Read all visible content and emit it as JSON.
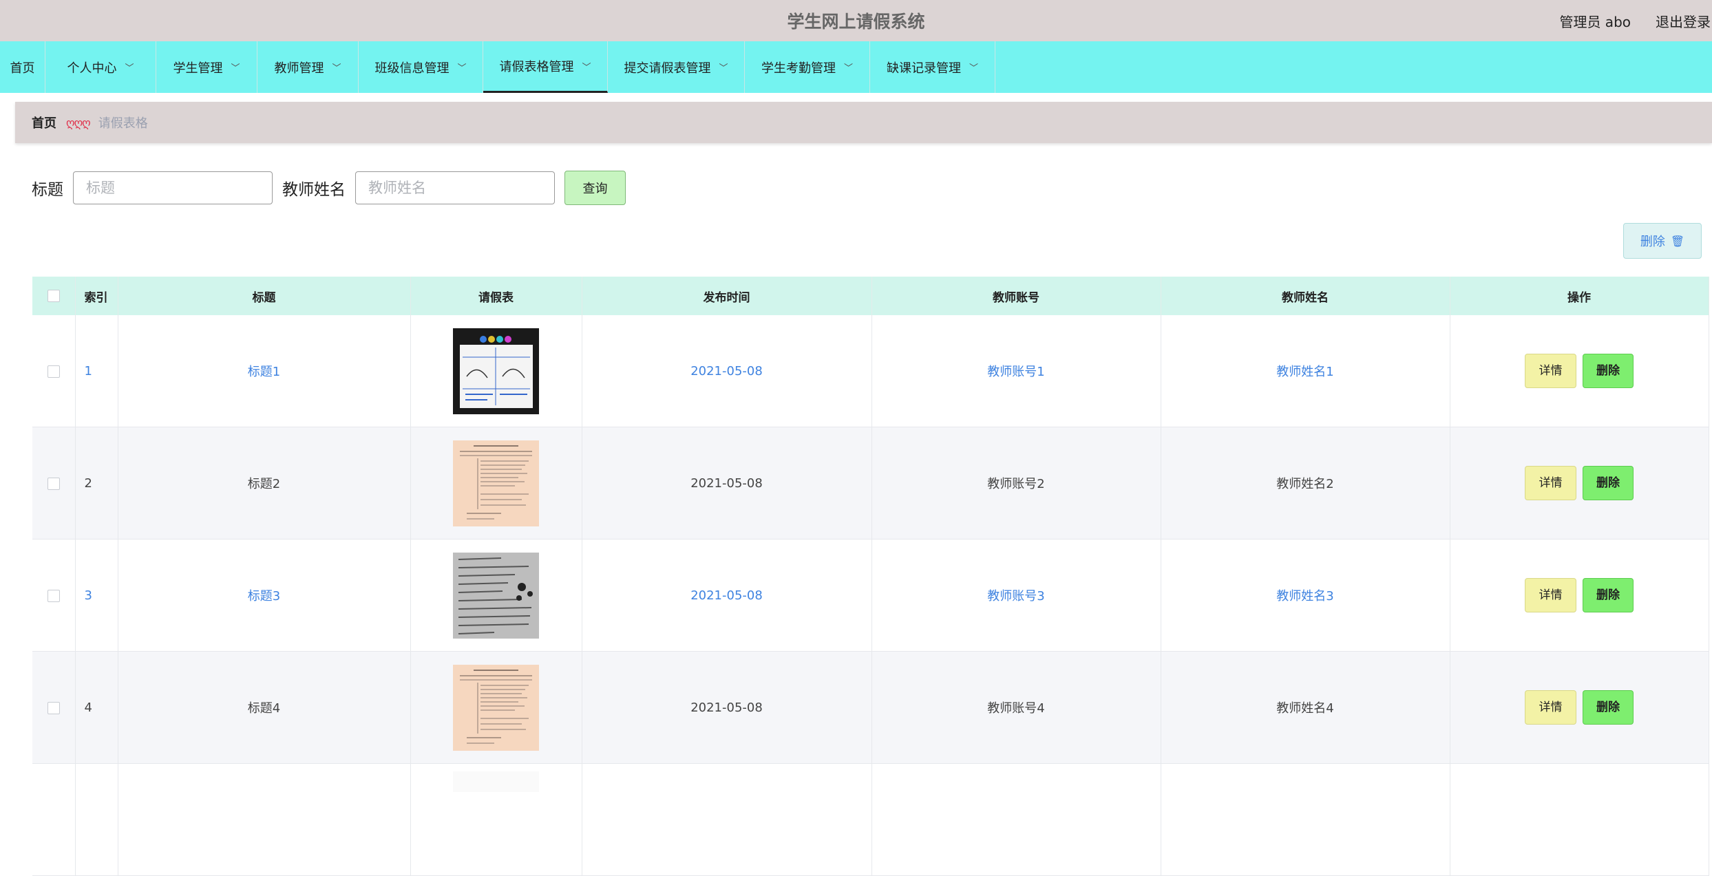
{
  "header": {
    "title": "学生网上请假系统",
    "admin_label": "管理员 abo",
    "logout": "退出登录"
  },
  "nav": {
    "items": [
      {
        "label": "首页",
        "dropdown": false
      },
      {
        "label": "个人中心",
        "dropdown": true
      },
      {
        "label": "学生管理",
        "dropdown": true
      },
      {
        "label": "教师管理",
        "dropdown": true
      },
      {
        "label": "班级信息管理",
        "dropdown": true
      },
      {
        "label": "请假表格管理",
        "dropdown": true,
        "active": true
      },
      {
        "label": "提交请假表管理",
        "dropdown": true
      },
      {
        "label": "学生考勤管理",
        "dropdown": true
      },
      {
        "label": "缺课记录管理",
        "dropdown": true
      }
    ]
  },
  "breadcrumb": {
    "home": "首页",
    "separator": "ღღღ",
    "current": "请假表格"
  },
  "search": {
    "title_label": "标题",
    "title_placeholder": "标题",
    "teacher_label": "教师姓名",
    "teacher_placeholder": "教师姓名",
    "query_button": "查询"
  },
  "toolbar": {
    "delete_label": "删除",
    "delete_icon": "trash-icon"
  },
  "table": {
    "columns": [
      "索引",
      "标题",
      "请假表",
      "发布时间",
      "教师账号",
      "教师姓名",
      "操作"
    ],
    "rows": [
      {
        "index": "1",
        "title": "标题1",
        "image": "form-image",
        "date": "2021-05-08",
        "account": "教师账号1",
        "name": "教师姓名1"
      },
      {
        "index": "2",
        "title": "标题2",
        "image": "form-image",
        "date": "2021-05-08",
        "account": "教师账号2",
        "name": "教师姓名2"
      },
      {
        "index": "3",
        "title": "标题3",
        "image": "form-image",
        "date": "2021-05-08",
        "account": "教师账号3",
        "name": "教师姓名3"
      },
      {
        "index": "4",
        "title": "标题4",
        "image": "form-image",
        "date": "2021-05-08",
        "account": "教师账号4",
        "name": "教师姓名4"
      }
    ],
    "detail_button": "详情",
    "delete_button": "删除"
  },
  "colors": {
    "nav_bg": "#74f3f0",
    "header_bg": "#dcd4d4",
    "link_blue": "#3f83e0",
    "table_header_bg": "#d1f5ec",
    "detail_btn": "#f3f2a6",
    "delete_btn": "#7eee6f"
  }
}
